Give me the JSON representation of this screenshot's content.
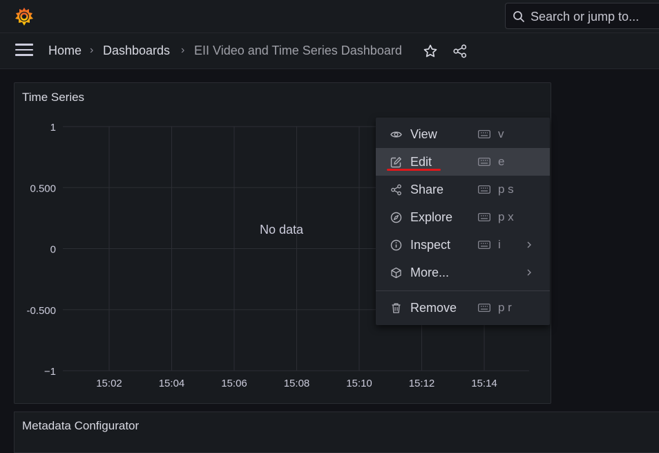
{
  "search": {
    "placeholder": "Search or jump to..."
  },
  "breadcrumb": {
    "home": "Home",
    "sep1": "›",
    "dashboards": "Dashboards",
    "sep2": "›",
    "current": "EII Video and Time Series Dashboard"
  },
  "panel": {
    "title": "Time Series",
    "no_data": "No data"
  },
  "panel2": {
    "title": "Metadata Configurator"
  },
  "chart_data": {
    "type": "line",
    "title": "Time Series",
    "y_ticks": [
      "1",
      "0.500",
      "0",
      "-0.500",
      "−1"
    ],
    "x_ticks": [
      "15:02",
      "15:04",
      "15:06",
      "15:08",
      "15:10",
      "15:12",
      "15:14"
    ],
    "ylim": [
      -1,
      1
    ],
    "grid": true,
    "series": []
  },
  "menu": {
    "items": [
      {
        "label": "View",
        "key": "v",
        "icon": "eye-icon"
      },
      {
        "label": "Edit",
        "key": "e",
        "icon": "edit-icon"
      },
      {
        "label": "Share",
        "key": "p s",
        "icon": "share-icon"
      },
      {
        "label": "Explore",
        "key": "p x",
        "icon": "compass-icon"
      },
      {
        "label": "Inspect",
        "key": "i",
        "icon": "info-icon"
      },
      {
        "label": "More...",
        "key": "",
        "icon": "cube-icon"
      },
      {
        "label": "Remove",
        "key": "p r",
        "icon": "trash-icon"
      }
    ]
  },
  "colors": {
    "accent": "#e0181b",
    "logo_orange": "#f46800",
    "logo_yellow": "#fbca0a"
  }
}
